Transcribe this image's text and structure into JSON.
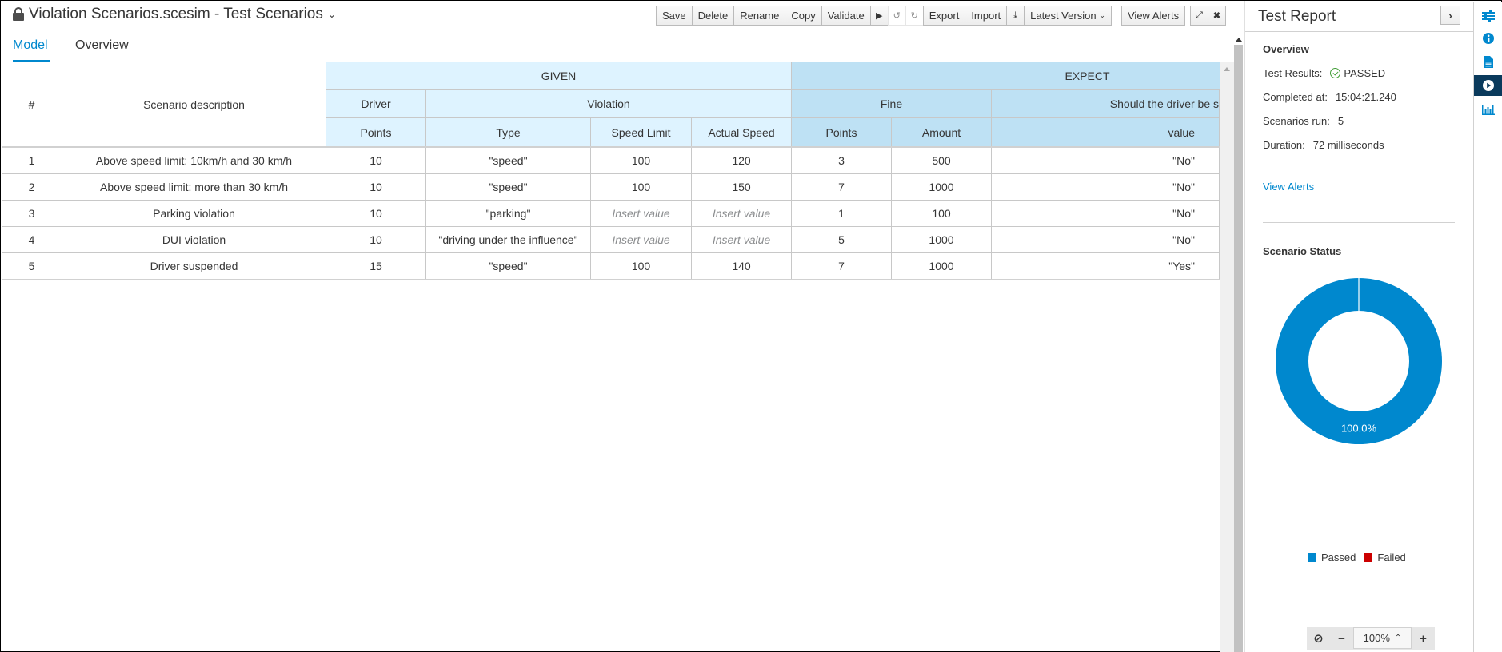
{
  "window": {
    "title": "Violation Scenarios.scesim - Test Scenarios"
  },
  "toolbar": {
    "save": "Save",
    "delete": "Delete",
    "rename": "Rename",
    "copy": "Copy",
    "validate": "Validate",
    "export": "Export",
    "import": "Import",
    "latest_version": "Latest Version",
    "view_alerts": "View Alerts"
  },
  "tabs": [
    {
      "label": "Model",
      "active": true
    },
    {
      "label": "Overview",
      "active": false
    }
  ],
  "table": {
    "index_header": "#",
    "description_header": "Scenario description",
    "groups": {
      "given": "GIVEN",
      "expect": "EXPECT"
    },
    "instances": {
      "driver": "Driver",
      "violation": "Violation",
      "fine": "Fine",
      "suspended": "Should the driver be s"
    },
    "properties": {
      "driver_points": "Points",
      "type": "Type",
      "speed_limit": "Speed Limit",
      "actual_speed": "Actual Speed",
      "fine_points": "Points",
      "amount": "Amount",
      "value": "value"
    },
    "placeholder": "Insert value",
    "rows": [
      {
        "index": "1",
        "description": "Above speed limit: 10km/h and 30 km/h",
        "driver_points": "10",
        "type": "\"speed\"",
        "speed_limit": "100",
        "actual_speed": "120",
        "fine_points": "3",
        "amount": "500",
        "suspended": "\"No\""
      },
      {
        "index": "2",
        "description": "Above speed limit: more than 30 km/h",
        "driver_points": "10",
        "type": "\"speed\"",
        "speed_limit": "100",
        "actual_speed": "150",
        "fine_points": "7",
        "amount": "1000",
        "suspended": "\"No\""
      },
      {
        "index": "3",
        "description": "Parking violation",
        "driver_points": "10",
        "type": "\"parking\"",
        "speed_limit": "Insert value",
        "actual_speed": "Insert value",
        "fine_points": "1",
        "amount": "100",
        "suspended": "\"No\""
      },
      {
        "index": "4",
        "description": "DUI violation",
        "driver_points": "10",
        "type": "\"driving under the influence\"",
        "speed_limit": "Insert value",
        "actual_speed": "Insert value",
        "fine_points": "5",
        "amount": "1000",
        "suspended": "\"No\""
      },
      {
        "index": "5",
        "description": "Driver suspended",
        "driver_points": "15",
        "type": "\"speed\"",
        "speed_limit": "100",
        "actual_speed": "140",
        "fine_points": "7",
        "amount": "1000",
        "suspended": "\"Yes\""
      }
    ]
  },
  "report": {
    "title": "Test Report",
    "overview_heading": "Overview",
    "test_results_label": "Test Results:",
    "test_results_value": "PASSED",
    "completed_label": "Completed at:",
    "completed_value": "15:04:21.240",
    "scenarios_label": "Scenarios run:",
    "scenarios_value": "5",
    "duration_label": "Duration:",
    "duration_value": "72 milliseconds",
    "view_alerts": "View Alerts",
    "status_heading": "Scenario Status",
    "zoom_value": "100%"
  },
  "chart_data": {
    "type": "pie",
    "title": "Scenario Status",
    "categories": [
      "Passed",
      "Failed"
    ],
    "values": [
      5,
      0
    ],
    "percent_labels": [
      "100.0%",
      ""
    ],
    "colors": [
      "#0088ce",
      "#cc0000"
    ],
    "donut": true,
    "legend": "bottom"
  },
  "colors": {
    "accent": "#0088ce",
    "given_header": "#def3ff",
    "expect_header": "#bee1f4",
    "passed": "#3f9c35"
  }
}
